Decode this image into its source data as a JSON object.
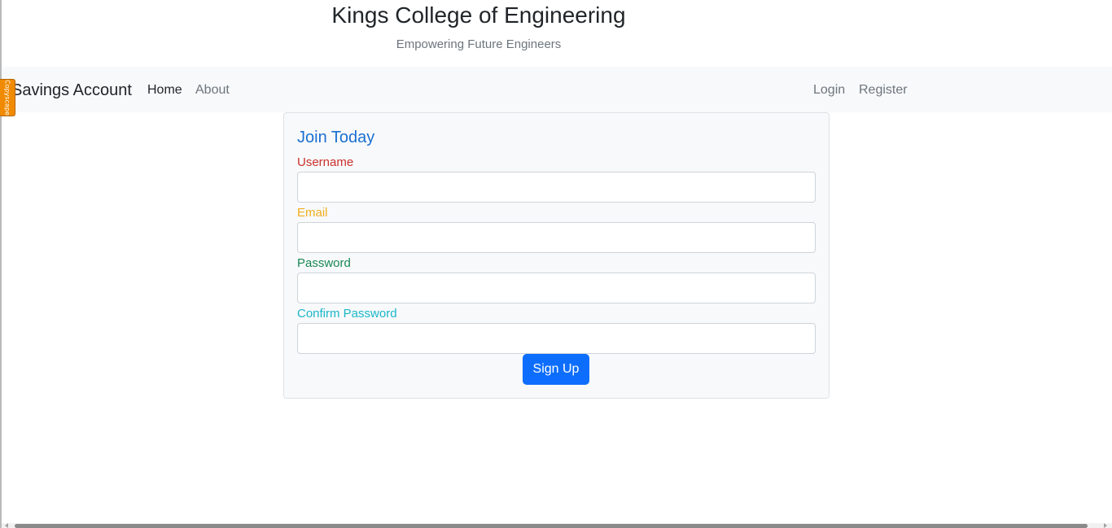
{
  "header": {
    "title": "Kings College of Engineering",
    "subtitle": "Empowering Future Engineers"
  },
  "navbar": {
    "brand": "Savings Account",
    "links": [
      {
        "label": "Home",
        "active": true
      },
      {
        "label": "About",
        "active": false
      }
    ],
    "auth_links": [
      {
        "label": "Login"
      },
      {
        "label": "Register"
      }
    ]
  },
  "extension_tab": {
    "label": "Copyscape",
    "color": "#f08a00"
  },
  "form": {
    "title": "Join Today",
    "fields": [
      {
        "label": "Username",
        "value": "",
        "color": "#c9302c"
      },
      {
        "label": "Email",
        "value": "",
        "color": "#f0ad1e"
      },
      {
        "label": "Password",
        "value": "",
        "color": "#198754"
      },
      {
        "label": "Confirm Password",
        "value": "",
        "color": "#1ab7c9"
      }
    ],
    "submit_label": "Sign Up"
  },
  "colors": {
    "accent": "#0d6efd",
    "title_blue": "#1a6fd1",
    "navbar_bg": "#f8f9fa"
  }
}
